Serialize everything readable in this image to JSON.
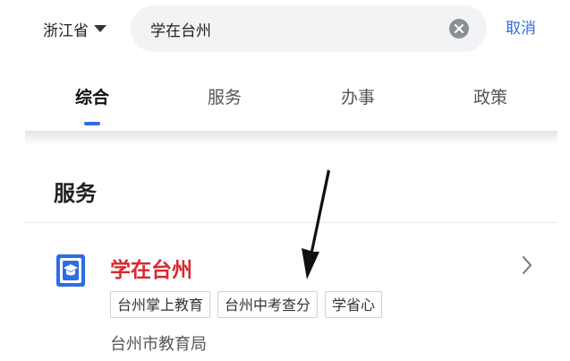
{
  "topbar": {
    "province_label": "浙江省",
    "search_value": "学在台州",
    "cancel_label": "取消"
  },
  "tabs": [
    {
      "label": "综合",
      "active": true
    },
    {
      "label": "服务",
      "active": false
    },
    {
      "label": "办事",
      "active": false
    },
    {
      "label": "政策",
      "active": false
    }
  ],
  "section": {
    "title": "服务"
  },
  "service": {
    "name": "学在台州",
    "icon": "graduation-cap-icon",
    "tags": [
      "台州掌上教育",
      "台州中考查分",
      "学省心"
    ],
    "publisher": "台州市教育局"
  },
  "colors": {
    "accent": "#2f6ce0",
    "service_name": "#d8292f",
    "search_bg": "#f2f3f5"
  }
}
